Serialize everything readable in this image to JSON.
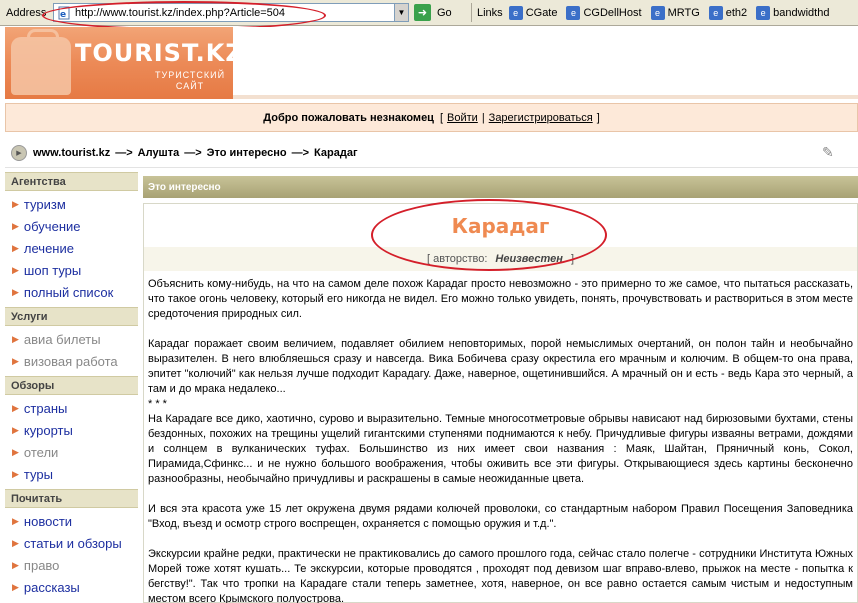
{
  "browser": {
    "address_label": "Address",
    "url": "http://www.tourist.kz/index.php?Article=504",
    "go_label": "Go",
    "links_label": "Links",
    "links": [
      "CGate",
      "CGDellHost",
      "MRTG",
      "eth2",
      "bandwidthd"
    ]
  },
  "header": {
    "logo_title": "TOURIST.KZ",
    "logo_sub_line1": "ТУРИСТСКИЙ",
    "logo_sub_line2": "САЙТ"
  },
  "welcome": {
    "text": "Добро пожаловать незнакомец",
    "open_bracket": "[",
    "login": "Войти",
    "divider": "|",
    "register": "Зарегистрироваться",
    "close_bracket": "]"
  },
  "breadcrumb": {
    "items": [
      "www.tourist.kz",
      "Алушта",
      "Это интересно",
      "Карадаг"
    ],
    "separator": "—>"
  },
  "sidebar": {
    "sections": [
      {
        "title": "Агентства",
        "items": [
          "туризм",
          "обучение",
          "лечение",
          "шоп туры",
          "полный список"
        ]
      },
      {
        "title": "Услуги",
        "items": [
          "авиа билеты",
          "визовая работа"
        ]
      },
      {
        "title": "Обзоры",
        "items": [
          "страны",
          "курорты",
          "отели",
          "туры"
        ]
      },
      {
        "title": "Почитать",
        "items": [
          "новости",
          "статьи и обзоры",
          "право",
          "рассказы"
        ]
      }
    ]
  },
  "content": {
    "section_title": "Это интересно",
    "article_title": "Карадаг",
    "author_open": "[ авторство:",
    "author_name": "Неизвестен",
    "author_close": "]",
    "paragraphs": [
      "Объяснить кому-нибудь, на что на самом деле похож Карадаг просто невозможно - это примерно то же самое, что пытаться рассказать, что такое огонь человеку, который его никогда не видел. Его можно только увидеть, понять, прочувствовать и раствориться в этом месте средоточения природных сил.",
      "Карадаг поражает своим величием, подавляет обилием неповторимых, порой немыслимых очертаний, он полон тайн и необычайно выразителен. В него влюбляешься сразу и навсегда. Вика Бобичева сразу окрестила его мрачным и колючим. В общем-то она права, эпитет \"колючий\" как нельзя лучше подходит Карадагу. Даже, наверное, ощетинившийся. А мрачный он и есть - ведь Кара это черный, а там и до мрака недалеко...",
      "* * *",
      "На Карадаге все дико, хаотично, сурово и выразительно. Темные многосотметровые обрывы нависают над бирюзовыми бухтами, стены бездонных, похожих на трещины ущелий гигантскими ступенями поднимаются к небу. Причудливые фигуры изваяны ветрами, дождями и солнцем в вулканических туфах. Большинство из них имеет свои названия : Маяк, Шайтан, Пряничный конь, Сокол, Пирамида,Сфинкс... и не нужно большого воображения, чтобы оживить все эти фигуры. Открывающиеся здесь картины бесконечно разнообразны, необычайно причудливы и раскрашены в самые неожиданные цвета.",
      "И вся эта красота уже 15 лет окружена двумя рядами колючей проволоки, со стандартным набором Правил Посещения Заповедника \"Вход, въезд и осмотр строго воспрещен, охраняется с помощью оружия и т.д.\".",
      "Экскурсии крайне редки, практически не практиковались до самого прошлого года, сейчас стало полегче - сотрудники Института Южных Морей тоже хотят кушать... Те экскурсии, которые проводятся , проходят под девизом шаг вправо-влево, прыжок на месте - попытка к бегству!\". Так что тропки на Карадаге стали теперь заметнее, хотя, наверное, он все равно остается самым чистым и недоступным местом всего Крымского полуострова."
    ]
  },
  "colors": {
    "accent_orange": "#ef8a51",
    "link_blue": "#1d2fa0",
    "annotation_red": "#d41f2a",
    "section_olive": "#a8a274"
  }
}
